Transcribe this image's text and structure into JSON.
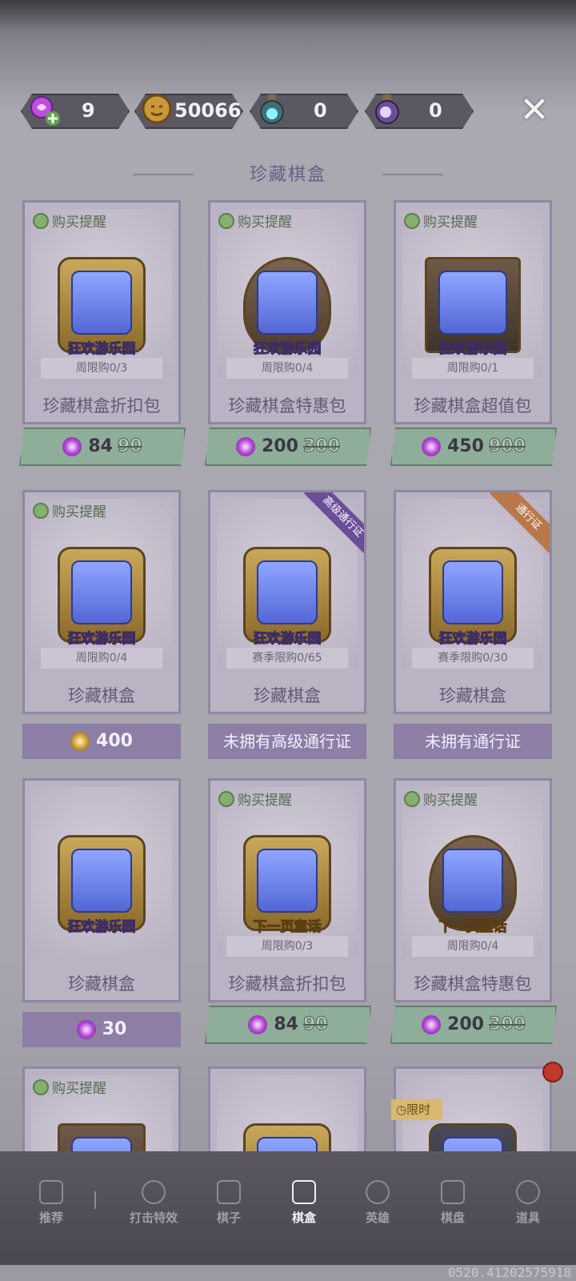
{
  "currencies": [
    {
      "icon": "candy-plus-icon",
      "value": "9"
    },
    {
      "icon": "pumpkin-coin-icon",
      "value": "50066"
    },
    {
      "icon": "teal-potion-icon",
      "value": "0"
    },
    {
      "icon": "purple-potion-icon",
      "value": "0"
    }
  ],
  "section_title": "珍藏棋盒",
  "cards": [
    {
      "remind": "购买提醒",
      "emblem_label": "狂欢游乐园",
      "limit": "周限购0/3",
      "name": "珍藏棋盒折扣包",
      "price": "84",
      "old_price": "90",
      "price_style": "green",
      "coin": "candy"
    },
    {
      "remind": "购买提醒",
      "emblem_label": "狂欢游乐园",
      "limit": "周限购0/4",
      "name": "珍藏棋盒特惠包",
      "price": "200",
      "old_price": "300",
      "price_style": "green",
      "coin": "candy"
    },
    {
      "remind": "购买提醒",
      "emblem_label": "狂欢游乐园",
      "limit": "周限购0/1",
      "name": "珍藏棋盒超值包",
      "price": "450",
      "old_price": "900",
      "price_style": "green",
      "coin": "candy"
    },
    {
      "remind": "购买提醒",
      "emblem_label": "狂欢游乐园",
      "limit": "周限购0/4",
      "name": "珍藏棋盒",
      "price": "400",
      "price_style": "purple",
      "coin": "gold"
    },
    {
      "ribbon": "高级通行证",
      "emblem_label": "狂欢游乐园",
      "limit": "赛季限购0/65",
      "name": "珍藏棋盒",
      "bar_text": "未拥有高级通行证",
      "price_style": "purple"
    },
    {
      "ribbon": "通行证",
      "emblem_label": "狂欢游乐园",
      "limit": "赛季限购0/30",
      "name": "珍藏棋盒",
      "bar_text": "未拥有通行证",
      "price_style": "purple"
    },
    {
      "emblem_label": "狂欢游乐园",
      "name": "珍藏棋盒",
      "price": "30",
      "price_style": "purple",
      "coin": "candy"
    },
    {
      "remind": "购买提醒",
      "emblem_label": "下一页童话",
      "limit": "周限购0/3",
      "name": "珍藏棋盒折扣包",
      "price": "84",
      "old_price": "90",
      "price_style": "green",
      "coin": "candy"
    },
    {
      "remind": "购买提醒",
      "emblem_label": "下一页童话",
      "limit": "周限购0/4",
      "name": "珍藏棋盒特惠包",
      "price": "200",
      "old_price": "300",
      "price_style": "green",
      "coin": "candy"
    },
    {
      "remind": "购买提醒"
    },
    {},
    {
      "tag": "限时"
    }
  ],
  "nav": [
    {
      "icon": "recommend-icon",
      "label": "推荐"
    },
    {
      "icon": "hit-effect-icon",
      "label": "打击特效"
    },
    {
      "icon": "chess-piece-icon",
      "label": "棋子"
    },
    {
      "icon": "chess-box-icon",
      "label": "棋盒",
      "active": true
    },
    {
      "icon": "hero-icon",
      "label": "英雄"
    },
    {
      "icon": "chessboard-icon",
      "label": "棋盘"
    },
    {
      "icon": "props-icon",
      "label": "道具"
    }
  ],
  "version": "0520.41202575918"
}
